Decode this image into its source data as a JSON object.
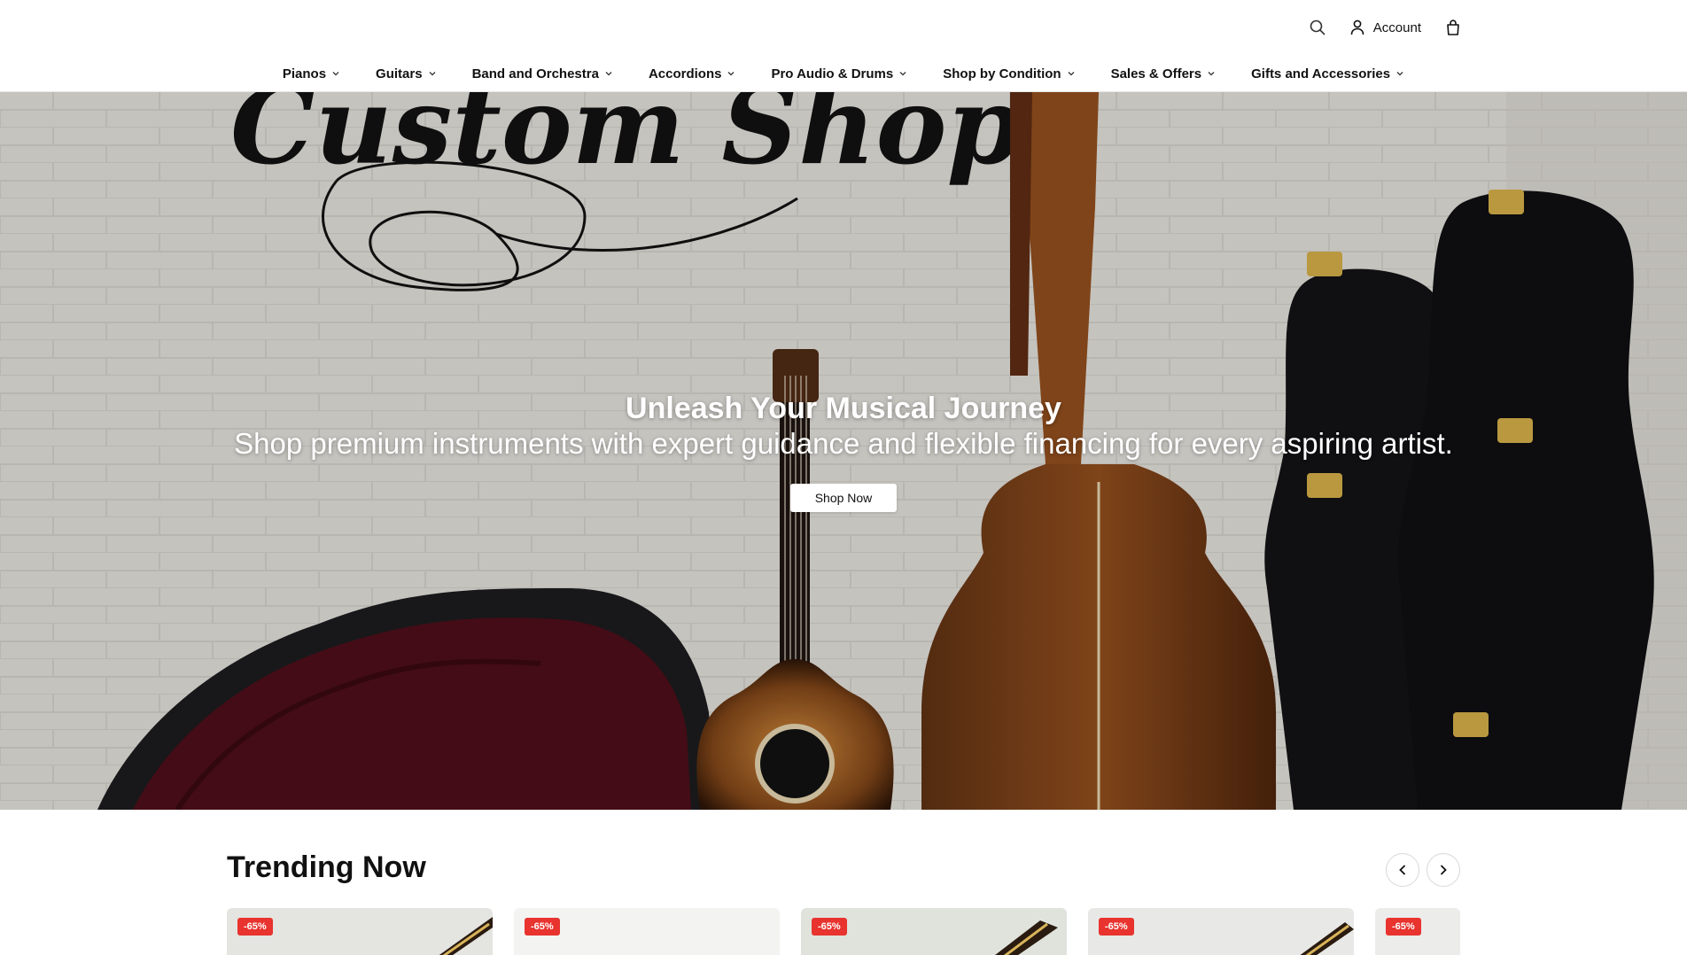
{
  "header": {
    "account_label": "Account",
    "icons": [
      "search-icon",
      "user-icon",
      "bag-icon"
    ]
  },
  "nav": {
    "items": [
      {
        "label": "Pianos"
      },
      {
        "label": "Guitars"
      },
      {
        "label": "Band and Orchestra"
      },
      {
        "label": "Accordions"
      },
      {
        "label": "Pro Audio & Drums"
      },
      {
        "label": "Shop by Condition"
      },
      {
        "label": "Sales & Offers"
      },
      {
        "label": "Gifts and Accessories"
      }
    ]
  },
  "hero": {
    "title": "Unleash Your Musical Journey",
    "subtitle": "Shop premium instruments with expert guidance and flexible financing for every aspiring artist.",
    "button_label": "Shop Now",
    "sign_text": "Custom Shop"
  },
  "trending": {
    "title": "Trending Now",
    "cards": [
      {
        "badge": "-65%"
      },
      {
        "badge": "-65%"
      },
      {
        "badge": "-65%"
      },
      {
        "badge": "-65%"
      },
      {
        "badge": "-65%"
      }
    ]
  },
  "colors": {
    "badge": "#e8332e",
    "text": "#111111",
    "hero_wall": "#d9d7d3"
  }
}
